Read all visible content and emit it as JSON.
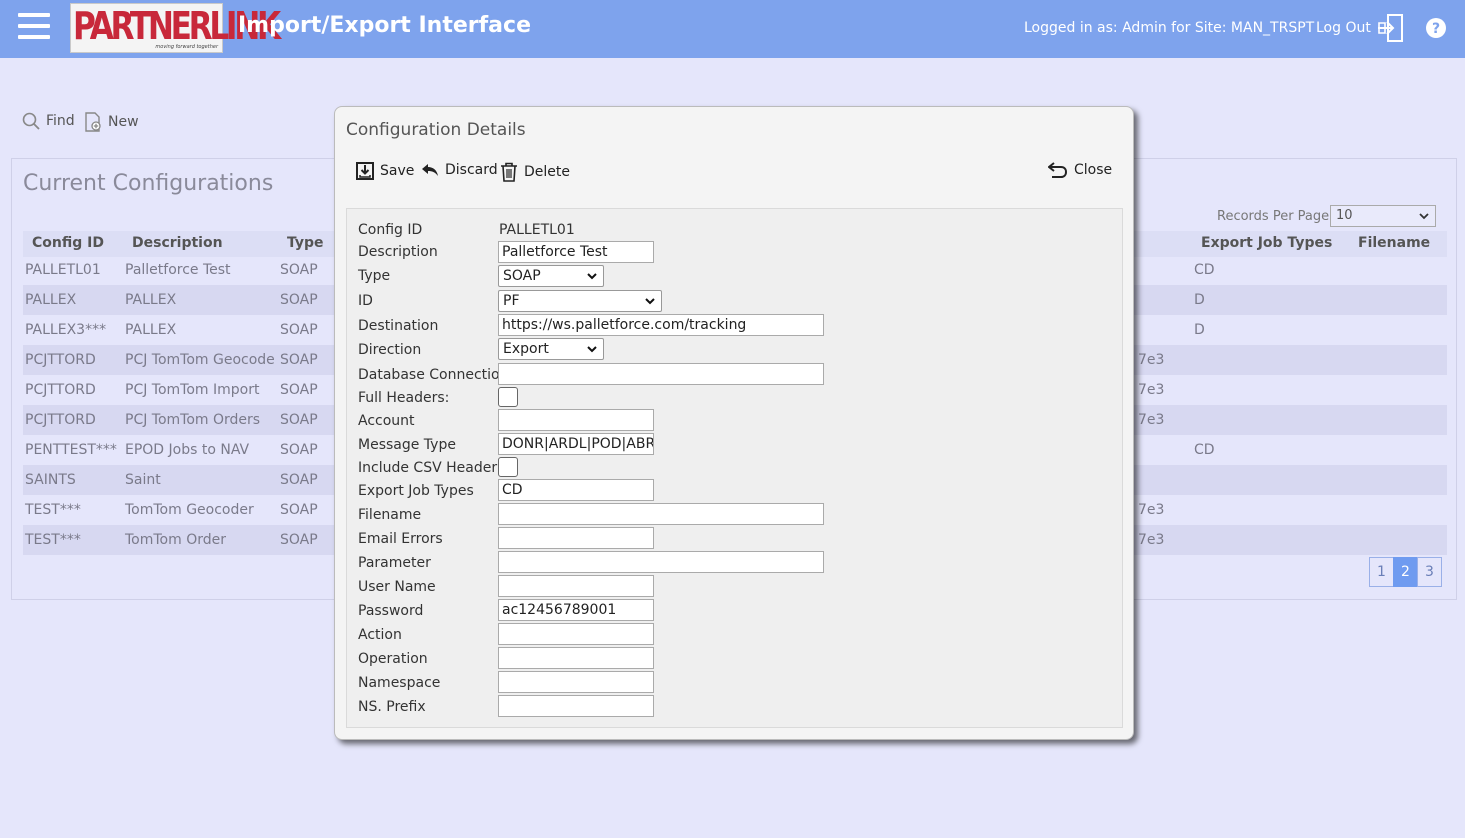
{
  "header": {
    "logo_text": "PARTNERLINK",
    "logo_tagline": "moving forward together",
    "title": "Import/Export Interface",
    "logged_in": "Logged in as: Admin for Site: MAN_TRSPT",
    "logout": "Log Out"
  },
  "toolbar": {
    "find": "Find",
    "new": "New"
  },
  "configs": {
    "title": "Current Configurations",
    "records_per_page_label": "Records Per Page:",
    "records_per_page": "10",
    "columns": {
      "config_id": "Config ID",
      "description": "Description",
      "type": "Type",
      "export_job_types": "Export Job Types",
      "filename": "Filename"
    },
    "rows": [
      {
        "id": "PALLETL01",
        "desc": "Palletforce Test",
        "type": "SOAP",
        "partial": "",
        "ejt": "CD",
        "filename": ""
      },
      {
        "id": "PALLEX",
        "desc": "PALLEX",
        "type": "SOAP",
        "partial": "",
        "ejt": "D",
        "filename": ""
      },
      {
        "id": "PALLEX3***",
        "desc": "PALLEX",
        "type": "SOAP",
        "partial": "",
        "ejt": "D",
        "filename": ""
      },
      {
        "id": "PCJTTORD",
        "desc": "PCJ TomTom Geocode",
        "type": "SOAP",
        "partial": "7e3",
        "ejt": "",
        "filename": ""
      },
      {
        "id": "PCJTTORD",
        "desc": "PCJ TomTom Import",
        "type": "SOAP",
        "partial": "7e3",
        "ejt": "",
        "filename": ""
      },
      {
        "id": "PCJTTORD",
        "desc": "PCJ TomTom Orders",
        "type": "SOAP",
        "partial": "7e3",
        "ejt": "",
        "filename": ""
      },
      {
        "id": "PENTTEST***",
        "desc": "EPOD Jobs to NAV",
        "type": "SOAP",
        "partial": "",
        "ejt": "CD",
        "filename": ""
      },
      {
        "id": "SAINTS",
        "desc": "Saint",
        "type": "SOAP",
        "partial": "",
        "ejt": "",
        "filename": ""
      },
      {
        "id": "TEST***",
        "desc": "TomTom Geocoder",
        "type": "SOAP",
        "partial": "7e3",
        "ejt": "",
        "filename": ""
      },
      {
        "id": "TEST***",
        "desc": "TomTom Order",
        "type": "SOAP",
        "partial": "7e3",
        "ejt": "",
        "filename": ""
      }
    ],
    "pages": [
      "1",
      "2",
      "3"
    ],
    "current_page": "2"
  },
  "modal": {
    "title": "Configuration Details",
    "buttons": {
      "save": "Save",
      "discard": "Discard",
      "delete": "Delete",
      "close": "Close"
    },
    "labels": {
      "config_id": "Config ID",
      "description": "Description",
      "type": "Type",
      "id": "ID",
      "destination": "Destination",
      "direction": "Direction",
      "db_connection": "Database Connection",
      "full_headers": "Full Headers:",
      "account": "Account",
      "message_type": "Message Type",
      "include_csv": "Include CSV Header",
      "export_job_types": "Export Job Types",
      "filename": "Filename",
      "email_errors": "Email Errors",
      "parameter": "Parameter",
      "user_name": "User Name",
      "password": "Password",
      "action": "Action",
      "operation": "Operation",
      "namespace": "Namespace",
      "ns_prefix": "NS. Prefix"
    },
    "values": {
      "config_id": "PALLETL01",
      "description": "Palletforce Test",
      "type": "SOAP",
      "id": "PF",
      "destination": "https://ws.palletforce.com/tracking",
      "direction": "Export",
      "db_connection": "",
      "account": "",
      "message_type": "DONR|ARDL|POD|ABRT",
      "export_job_types": "CD",
      "filename": "",
      "email_errors": "",
      "parameter": "",
      "user_name": "",
      "password": "ac12456789001",
      "action": "",
      "operation": "",
      "namespace": "",
      "ns_prefix": ""
    }
  }
}
